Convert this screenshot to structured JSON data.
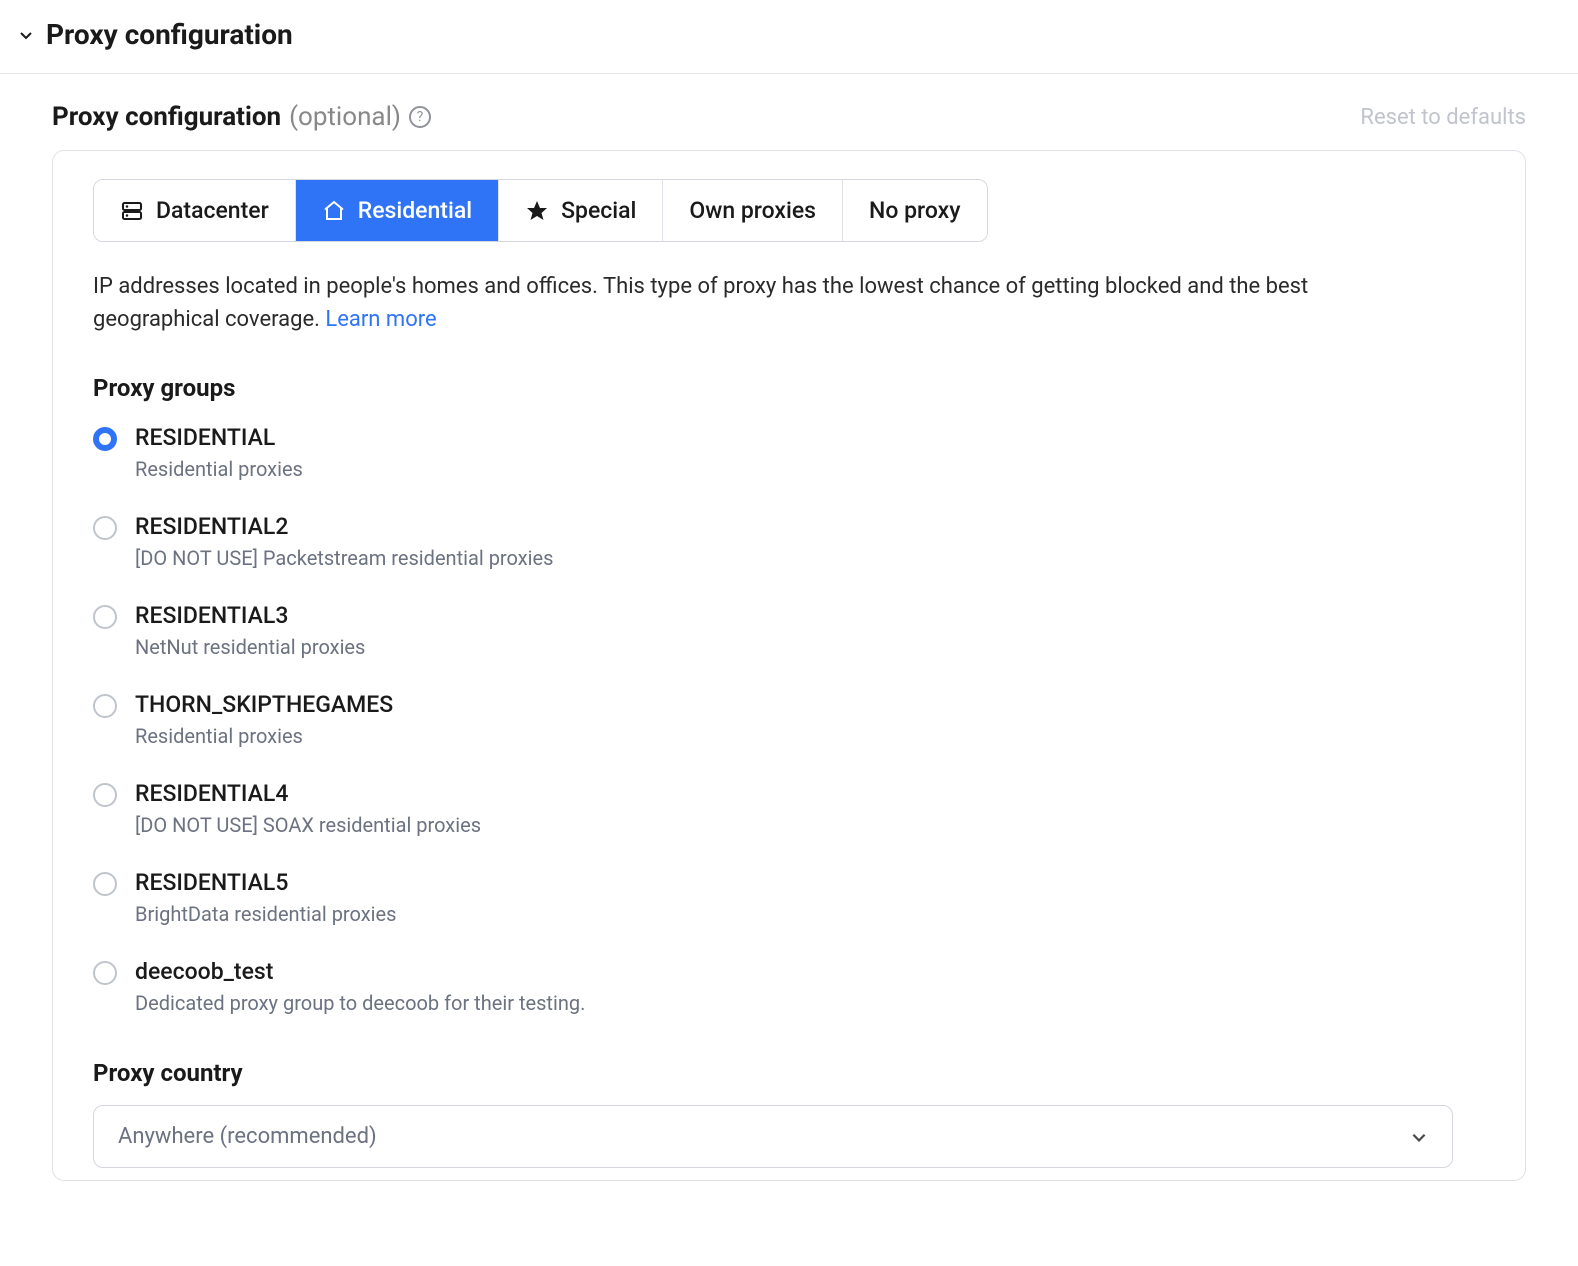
{
  "header": {
    "title": "Proxy configuration"
  },
  "config": {
    "label": "Proxy configuration",
    "optional": "(optional)",
    "reset": "Reset to defaults"
  },
  "tabs": {
    "datacenter": "Datacenter",
    "residential": "Residential",
    "special": "Special",
    "own": "Own proxies",
    "none": "No proxy"
  },
  "description": {
    "text": "IP addresses located in people's homes and offices. This type of proxy has the lowest chance of getting blocked and the best geographical coverage. ",
    "learn_more": "Learn more"
  },
  "groups": {
    "heading": "Proxy groups",
    "items": [
      {
        "title": "RESIDENTIAL",
        "sub": "Residential proxies",
        "selected": true
      },
      {
        "title": "RESIDENTIAL2",
        "sub": "[DO NOT USE] Packetstream residential proxies",
        "selected": false
      },
      {
        "title": "RESIDENTIAL3",
        "sub": "NetNut residential proxies",
        "selected": false
      },
      {
        "title": "THORN_SKIPTHEGAMES",
        "sub": "Residential proxies",
        "selected": false
      },
      {
        "title": "RESIDENTIAL4",
        "sub": "[DO NOT USE] SOAX residential proxies",
        "selected": false
      },
      {
        "title": "RESIDENTIAL5",
        "sub": "BrightData residential proxies",
        "selected": false
      },
      {
        "title": "deecoob_test",
        "sub": "Dedicated proxy group to deecoob for their testing.",
        "selected": false
      }
    ]
  },
  "country": {
    "heading": "Proxy country",
    "selected": "Anywhere (recommended)"
  }
}
